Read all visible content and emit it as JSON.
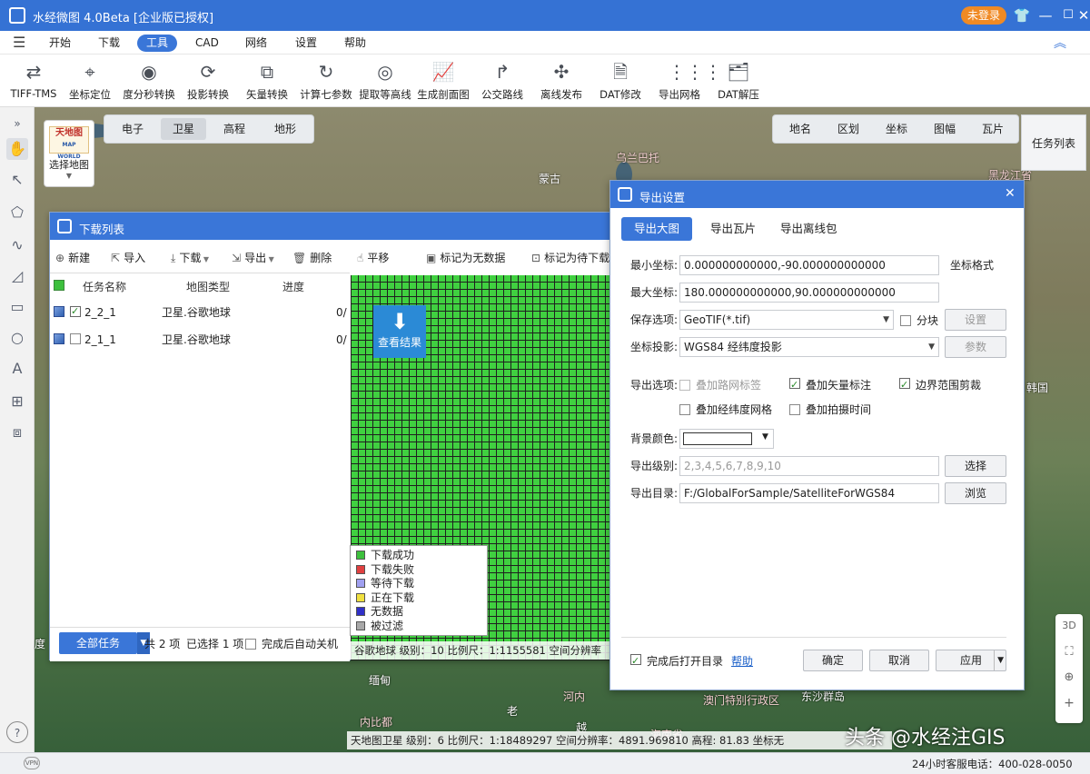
{
  "app": {
    "title": "水经微图 4.0Beta [企业版已授权]",
    "login_label": "未登录",
    "window_buttons": [
      "shirt-icon",
      "menu-icon",
      "minimize-icon",
      "maximize-icon",
      "close-icon"
    ]
  },
  "menu": {
    "items": [
      "开始",
      "下载",
      "工具",
      "CAD",
      "网络",
      "设置",
      "帮助"
    ],
    "active": "工具"
  },
  "toolbar": {
    "tools": [
      {
        "label": "TIFF-TMS",
        "icon": "swap-icon"
      },
      {
        "label": "坐标定位",
        "icon": "crosshair-icon"
      },
      {
        "label": "度分秒转换",
        "icon": "target-icon"
      },
      {
        "label": "投影转换",
        "icon": "globe-rotate-icon"
      },
      {
        "label": "矢量转换",
        "icon": "layers-convert-icon"
      },
      {
        "label": "计算七参数",
        "icon": "cycle-icon"
      },
      {
        "label": "提取等高线",
        "icon": "contour-icon"
      },
      {
        "label": "生成剖面图",
        "icon": "profile-chart-icon"
      },
      {
        "label": "公交路线",
        "icon": "route-icon"
      },
      {
        "label": "离线发布",
        "icon": "publish-icon"
      },
      {
        "label": "DAT修改",
        "icon": "dat-file-icon"
      },
      {
        "label": "导出网格",
        "icon": "grid-icon"
      },
      {
        "label": "DAT解压",
        "icon": "unzip-icon"
      }
    ]
  },
  "map": {
    "source_logo_lines": [
      "天地图",
      "MAP WORLD"
    ],
    "source_caption": "选择地图",
    "layer_tabs": [
      "电子",
      "卫星",
      "高程",
      "地形"
    ],
    "active_layer": "卫星",
    "overlay_tabs": [
      "地名",
      "区划",
      "坐标",
      "图幅",
      "瓦片"
    ],
    "task_list_label": "任务列表",
    "labels": [
      "蒙古",
      "乌兰巴托",
      "黑龙江省",
      "韩国",
      "缅甸",
      "老",
      "河内",
      "越",
      "海南省",
      "澳门特别行政区",
      "东沙群岛",
      "内比都",
      "度"
    ],
    "right_controls": [
      "3D",
      "fullscreen-icon",
      "locate-icon",
      "+",
      "−"
    ]
  },
  "download_list": {
    "title": "下载列表",
    "toolbar": [
      "新建",
      "导入",
      "下载",
      "导出",
      "删除",
      "平移",
      "标记为无数据",
      "标记为待下载"
    ],
    "columns": [
      "任务名称",
      "地图类型",
      "进度"
    ],
    "rows": [
      {
        "name": "2_2_1",
        "map_type": "卫星.谷歌地球",
        "progress": "0/",
        "checked": true
      },
      {
        "name": "2_1_1",
        "map_type": "卫星.谷歌地球",
        "progress": "0/",
        "checked": false
      }
    ],
    "view_result": "查看结果",
    "legend": [
      {
        "label": "下载成功",
        "color": "#3dc03d"
      },
      {
        "label": "下载失败",
        "color": "#e04040"
      },
      {
        "label": "等待下载",
        "color": "#a0a0f0"
      },
      {
        "label": "正在下载",
        "color": "#f0e040"
      },
      {
        "label": "无数据",
        "color": "#3030c8"
      },
      {
        "label": "被过滤",
        "color": "#a8a8a8"
      }
    ],
    "footer": {
      "all_tasks": "全部任务",
      "count": "共 2 项",
      "selected": "已选择 1 项",
      "auto_shutdown": "完成后自动关机"
    },
    "grid_status": "谷歌地球   级别：10  比例尺：1:1155581    空间分辨率"
  },
  "export": {
    "title": "导出设置",
    "tabs": [
      "导出大图",
      "导出瓦片",
      "导出离线包"
    ],
    "active_tab": "导出大图",
    "min_coord_label": "最小坐标:",
    "min_coord": "0.000000000000,-90.000000000000",
    "max_coord_label": "最大坐标:",
    "max_coord": "180.000000000000,90.000000000000",
    "coord_format": "坐标格式",
    "save_option_label": "保存选项:",
    "save_option": "GeoTIF(*.tif)",
    "split_label": "分块",
    "settings_btn": "设置",
    "projection_label": "坐标投影:",
    "projection": "WGS84 经纬度投影",
    "params_btn": "参数",
    "export_options_label": "导出选项:",
    "options": [
      {
        "label": "叠加路网标签",
        "checked": false,
        "enabled": false
      },
      {
        "label": "叠加矢量标注",
        "checked": true,
        "enabled": true
      },
      {
        "label": "边界范围剪裁",
        "checked": true,
        "enabled": true
      },
      {
        "label": "叠加经纬度网格",
        "checked": false,
        "enabled": true
      },
      {
        "label": "叠加拍摄时间",
        "checked": false,
        "enabled": true
      }
    ],
    "bg_color_label": "背景颜色:",
    "bg_color": "#ffffff",
    "levels_label": "导出级别:",
    "levels": "2,3,4,5,6,7,8,9,10",
    "select_btn": "选择",
    "dir_label": "导出目录:",
    "dir": "F:/GlobalForSample/SatelliteForWGS84",
    "browse_btn": "浏览",
    "open_dir_label": "完成后打开目录",
    "help_link": "帮助",
    "ok_btn": "确定",
    "cancel_btn": "取消",
    "apply_btn": "应用"
  },
  "status": {
    "text": "天地图卫星  级别：6   比例尺：1:18489297    空间分辨率：4891.969810      高程:       81.83  坐标无"
  },
  "bottom": {
    "hotline": "24小时客服电话：400-028-0050",
    "watermark": "头条 @水经注GIS"
  },
  "colors": {
    "brand_blue": "#3a76d8",
    "login_orange": "#f08a24",
    "tile_green": "#40d040"
  }
}
